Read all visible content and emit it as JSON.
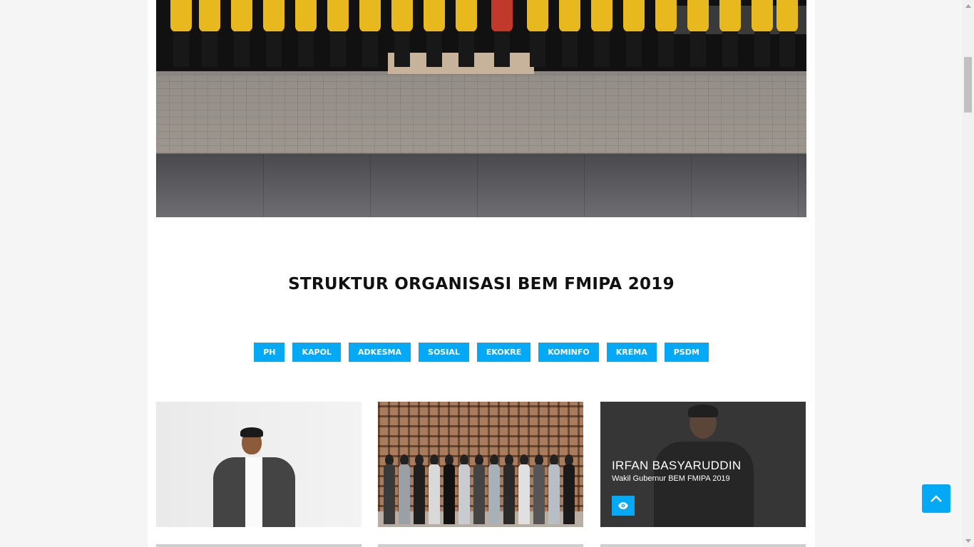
{
  "section": {
    "title": "STRUKTUR ORGANISASI BEM FMIPA 2019"
  },
  "filters": [
    "PH",
    "KAPOL",
    "ADKESMA",
    "SOSIAL",
    "EKOKRE",
    "KOMINFO",
    "KREMA",
    "PSDM"
  ],
  "cards": [
    {
      "name": "",
      "role": ""
    },
    {
      "name": "",
      "role": ""
    },
    {
      "name": "IRFAN BASYARUDDIN",
      "role": "Wakil Gubernur BEM FMIPA 2019",
      "view_icon": "eye-icon"
    }
  ],
  "colors": {
    "accent": "#03a9f4",
    "background": "#f5f5f5",
    "panel": "#ffffff"
  },
  "icons": {
    "back_to_top": "chevron-up-icon",
    "view": "eye-icon"
  }
}
